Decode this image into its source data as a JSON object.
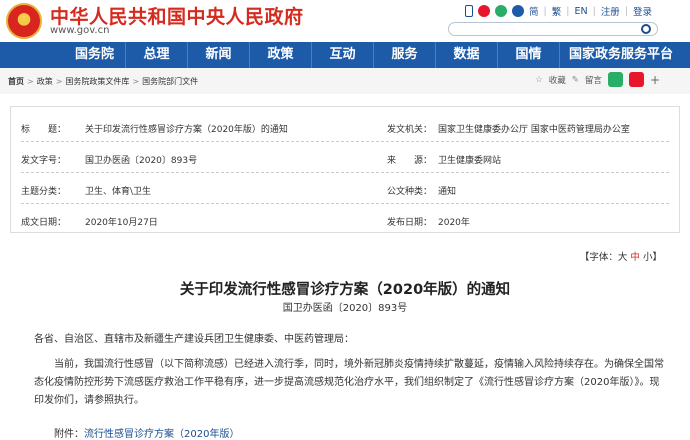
{
  "header": {
    "site_title": "中华人民共和国中央人民政府",
    "site_url": "www.gov.cn",
    "links": [
      "简",
      "繁",
      "EN",
      "注册",
      "登录"
    ]
  },
  "nav": {
    "items": [
      "国务院",
      "总理",
      "新闻",
      "政策",
      "互动",
      "服务",
      "数据",
      "国情",
      "国家政务服务平台"
    ]
  },
  "breadcrumb": {
    "items": [
      "首页",
      "政策",
      "国务院政策文件库",
      "国务院部门文件"
    ]
  },
  "tools": {
    "favorite": "收藏",
    "comment": "留言"
  },
  "info": {
    "rows": [
      {
        "k1": "标　　题：",
        "v1": "关于印发流行性感冒诊疗方案（2020年版）的通知",
        "k2": "发文机关：",
        "v2": "国家卫生健康委办公厅 国家中医药管理局办公室"
      },
      {
        "k1": "发文字号：",
        "v1": "国卫办医函〔2020〕893号",
        "k2": "来　　源：",
        "v2": "卫生健康委网站"
      },
      {
        "k1": "主题分类：",
        "v1": "卫生、体育\\卫生",
        "k2": "公文种类：",
        "v2": "通知"
      },
      {
        "k1": "成文日期：",
        "v1": "2020年10月27日",
        "k2": "发布日期：",
        "v2": "2020年"
      }
    ]
  },
  "font_size": {
    "prefix": "【字体：",
    "large": "大",
    "medium": "中",
    "small": "小",
    "suffix": "】"
  },
  "doc": {
    "title": "关于印发流行性感冒诊疗方案（2020年版）的通知",
    "number": "国卫办医函〔2020〕893号",
    "salutation": "各省、自治区、直辖市及新疆生产建设兵团卫生健康委、中医药管理局：",
    "body": "当前，我国流行性感冒（以下简称流感）已经进入流行季，同时，境外新冠肺炎疫情持续扩散蔓延，疫情输入风险持续存在。为确保全国常态化疫情防控形势下流感医疗救治工作平稳有序，进一步提高流感规范化治疗水平，我们组织制定了《流行性感冒诊疗方案（2020年版）》。现印发你们，请参照执行。",
    "attach_label": "附件：",
    "attach_link": "流行性感冒诊疗方案（2020年版）"
  },
  "colors": {
    "brand_red": "#d52b1e",
    "nav_blue": "#1d5ba8",
    "link_blue": "#1a4e91"
  }
}
